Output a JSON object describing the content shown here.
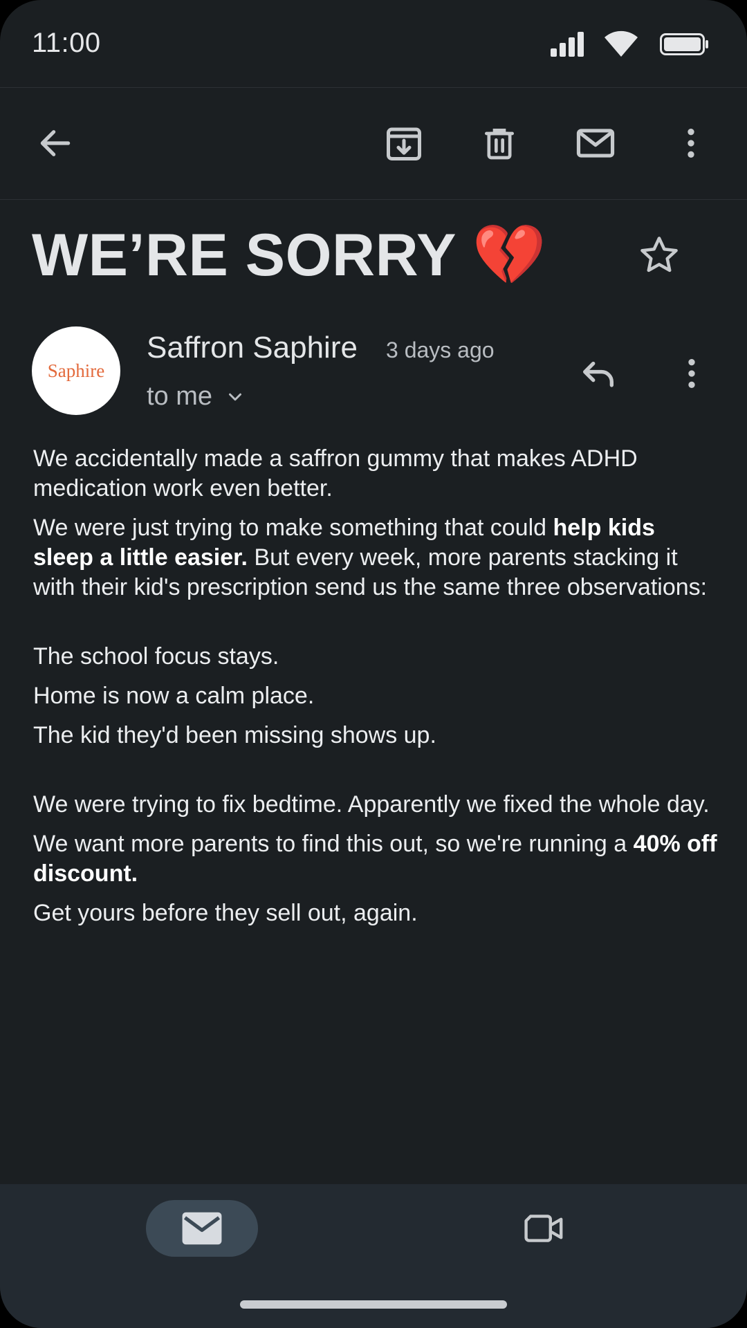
{
  "status_bar": {
    "time": "11:00",
    "icons": [
      "signal-icon",
      "wifi-icon",
      "battery-icon"
    ]
  },
  "toolbar": {
    "icons": [
      "back-arrow-icon",
      "archive-icon",
      "trash-icon",
      "mark-unread-icon",
      "more-vert-icon"
    ]
  },
  "email": {
    "subject": "WE’RE SORRY 💔",
    "starred": false,
    "sender": {
      "avatar_text": "Saphire",
      "name": "Saffron Saphire",
      "time": "3 days ago",
      "recipient": "to me"
    },
    "body": {
      "p1": "We accidentally made a saffron gummy that makes ADHD medication work even better.",
      "p2_start": "We were just trying to make something that could ",
      "p2_bold": "help kids sleep a little easier.",
      "p2_end": " But every week, more parents stacking it with their kid's prescription send us the same three observations:",
      "obs1": "The school focus stays.",
      "obs2": "Home is now a calm place.",
      "obs3": "The kid they'd been missing shows up.",
      "p3": "We were trying to fix bedtime. Apparently we fixed the whole day.",
      "p4_start": "We want more parents to find this out, so we're running a ",
      "p4_bold": "40% off discount.",
      "p5": "Get yours before they sell out, again."
    }
  },
  "bottom_nav": {
    "items": [
      {
        "icon": "mail-icon",
        "selected": true
      },
      {
        "icon": "video-camera-icon",
        "selected": false
      }
    ]
  },
  "colors": {
    "background": "#1b1f22",
    "bottom_nav": "#232a31",
    "selected_pill": "#3c4a56",
    "avatar_text": "#e36a3c"
  }
}
